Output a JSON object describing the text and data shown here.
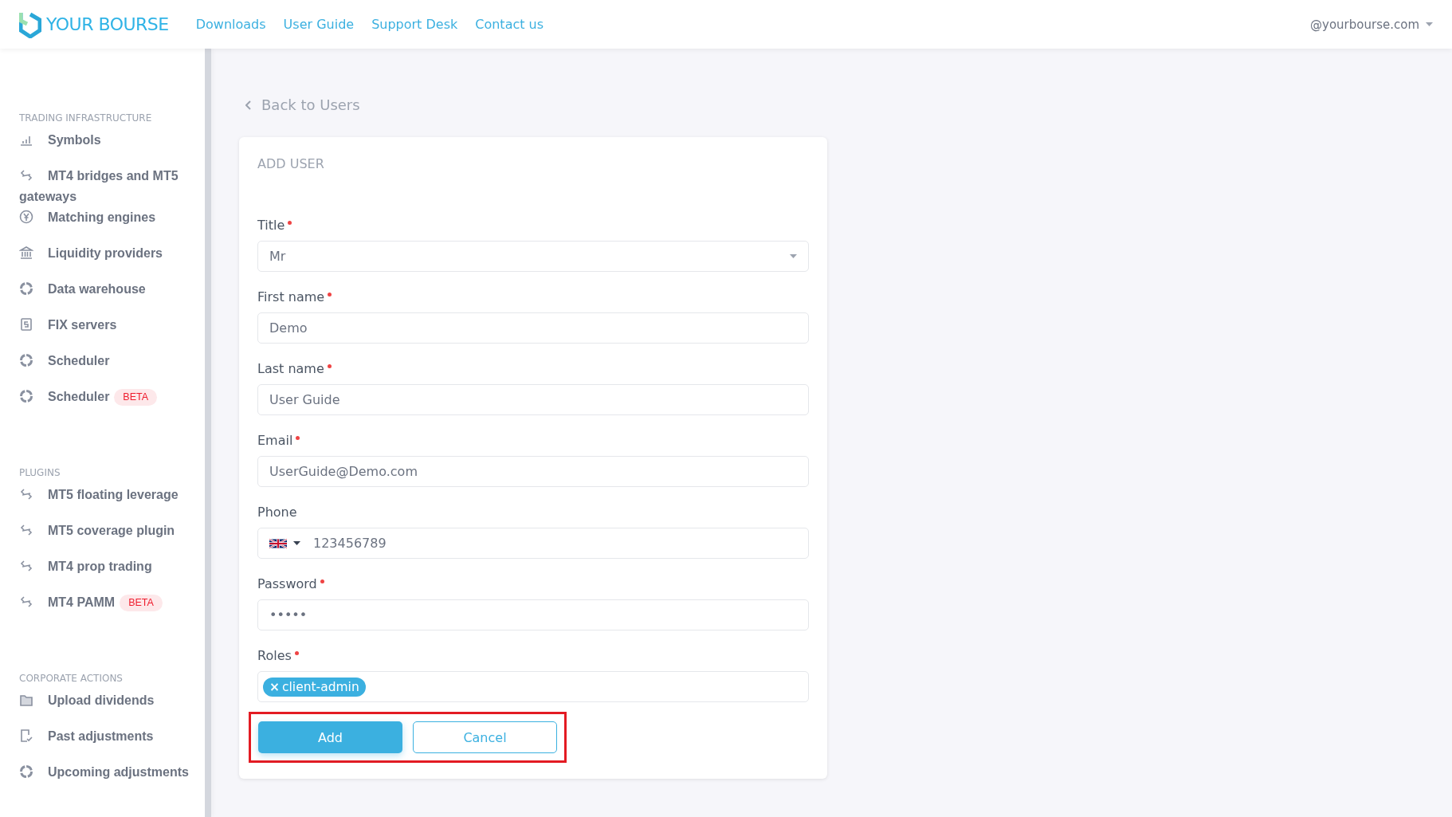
{
  "header": {
    "logo": "YOUR BOURSE",
    "nav": [
      {
        "label": "Downloads"
      },
      {
        "label": "User Guide"
      },
      {
        "label": "Support Desk"
      },
      {
        "label": "Contact us"
      }
    ],
    "account": "@yourbourse.com"
  },
  "sidebar": {
    "sections": [
      {
        "title": "TRADING INFRASTRUCTURE",
        "items": [
          {
            "label": "Symbols",
            "kind": "bars"
          },
          {
            "label": "MT4 bridges and MT5 gateways",
            "kind": "link"
          },
          {
            "label": "Matching engines",
            "kind": "yen"
          },
          {
            "label": "Liquidity providers",
            "kind": "bank"
          },
          {
            "label": "Data warehouse",
            "kind": "ring"
          },
          {
            "label": "FIX servers",
            "kind": "doc"
          },
          {
            "label": "Scheduler",
            "kind": "ring"
          },
          {
            "label": "Scheduler",
            "kind": "ring",
            "badge": "BETA"
          }
        ]
      },
      {
        "title": "PLUGINS",
        "items": [
          {
            "label": "MT5 floating leverage",
            "kind": "link"
          },
          {
            "label": "MT5 coverage plugin",
            "kind": "link"
          },
          {
            "label": "MT4 prop trading",
            "kind": "link"
          },
          {
            "label": "MT4 PAMM",
            "kind": "link",
            "badge": "BETA"
          }
        ]
      },
      {
        "title": "CORPORATE ACTIONS",
        "items": [
          {
            "label": "Upload dividends",
            "kind": "folder"
          },
          {
            "label": "Past adjustments",
            "kind": "check"
          },
          {
            "label": "Upcoming adjustments",
            "kind": "ring"
          }
        ]
      }
    ]
  },
  "back_link": "Back to Users",
  "form": {
    "title": "ADD USER",
    "fields": [
      {
        "kind": "select",
        "label": "Title",
        "required": true,
        "value": "Mr"
      },
      {
        "kind": "text",
        "label": "First name",
        "required": true,
        "value": "Demo"
      },
      {
        "kind": "text",
        "label": "Last name",
        "required": true,
        "value": "User Guide"
      },
      {
        "kind": "text",
        "label": "Email",
        "required": true,
        "value": "UserGuide@Demo.com"
      },
      {
        "kind": "phone",
        "label": "Phone",
        "required": false,
        "value": "123456789"
      },
      {
        "kind": "password",
        "label": "Password",
        "required": true,
        "value": "•••••"
      },
      {
        "kind": "tags",
        "label": "Roles",
        "required": true,
        "tags": [
          {
            "remove": "×",
            "label": "client-admin"
          }
        ]
      }
    ],
    "actions": {
      "highlighted": true,
      "buttons": [
        {
          "kind": "primary",
          "label": "Add"
        },
        {
          "kind": "secondary",
          "label": "Cancel"
        }
      ]
    }
  }
}
